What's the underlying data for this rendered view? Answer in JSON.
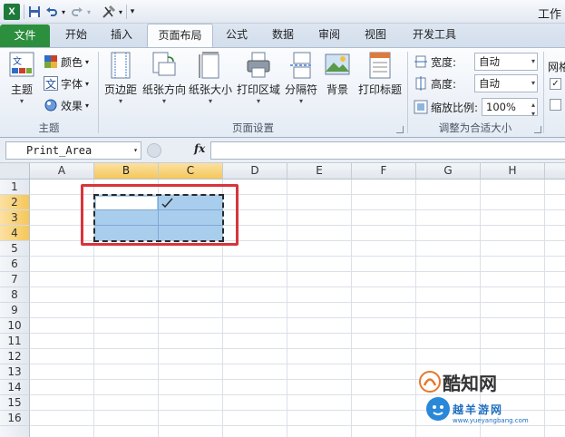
{
  "title_bar": {
    "app_icon_letter": "X",
    "window_title": "工作"
  },
  "tabs": [
    {
      "label": "文件"
    },
    {
      "label": "开始"
    },
    {
      "label": "插入"
    },
    {
      "label": "页面布局"
    },
    {
      "label": "公式"
    },
    {
      "label": "数据"
    },
    {
      "label": "审阅"
    },
    {
      "label": "视图"
    },
    {
      "label": "开发工具"
    }
  ],
  "ribbon": {
    "theme_group": {
      "label": "主题",
      "themes_button": "主题",
      "colors": "颜色",
      "fonts": "字体",
      "effects": "效果"
    },
    "page_setup_group": {
      "label": "页面设置",
      "buttons": [
        "页边距",
        "纸张方向",
        "纸张大小",
        "打印区域",
        "分隔符",
        "背景",
        "打印标题"
      ]
    },
    "scale_group": {
      "label": "调整为合适大小",
      "width_label": "宽度:",
      "width_value": "自动",
      "height_label": "高度:",
      "height_value": "自动",
      "scale_label": "缩放比例:",
      "scale_value": "100%"
    },
    "sheet_options_group": {
      "label_partial": "网格",
      "gridlines_view_checked": true,
      "gridlines_print_checked": false
    }
  },
  "formula_bar": {
    "name_box": "Print_Area",
    "fx_label": "fx",
    "formula": ""
  },
  "grid": {
    "columns": [
      "A",
      "B",
      "C",
      "D",
      "E",
      "F",
      "G",
      "H"
    ],
    "selected_columns": [
      "B",
      "C"
    ],
    "rows": [
      "1",
      "2",
      "3",
      "4",
      "5",
      "6",
      "7",
      "8",
      "9",
      "10",
      "11",
      "12",
      "13",
      "14",
      "15",
      "16"
    ],
    "selected_rows": [
      "2",
      "3",
      "4"
    ],
    "selection_range": "B2:C4"
  },
  "watermark": {
    "brand": "酷知网",
    "site_name": "越羊游网",
    "url": "www.yueyangbang.com"
  },
  "colors": {
    "file_tab": "#2c8f3e",
    "selection_fill": "#a9cdec",
    "header_highlight": "#f5c75a",
    "annotation_box": "#d9343b"
  }
}
